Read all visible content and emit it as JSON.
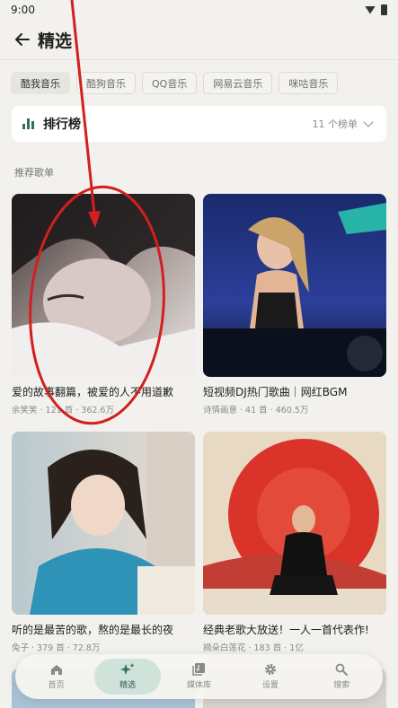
{
  "status": {
    "time": "9:00"
  },
  "header": {
    "title": "精选"
  },
  "sources": [
    "酷我音乐",
    "酷狗音乐",
    "QQ音乐",
    "网易云音乐",
    "咪咕音乐"
  ],
  "rank": {
    "title": "排行榜",
    "count": "11 个榜单"
  },
  "section": {
    "label": "推荐歌单"
  },
  "playlists": [
    {
      "title": "爱的故事翻篇，被爱的人不用道歉",
      "meta": "余笑笑 · 121 首 · 362.6万"
    },
    {
      "title": "短视频DJ热门歌曲｜网红BGM",
      "meta": "诗情画意 · 41 首 · 460.5万"
    },
    {
      "title": "听的是最苦的歌，熬的是最长的夜",
      "meta": "兔子 · 379 首 · 72.8万"
    },
    {
      "title": "经典老歌大放送！一人一首代表作!",
      "meta": "摘朵白莲花 · 183 首 · 1亿"
    }
  ],
  "nav": [
    {
      "label": "首页",
      "icon": "home-icon"
    },
    {
      "label": "精选",
      "icon": "sparkle-icon"
    },
    {
      "label": "媒体库",
      "icon": "library-icon"
    },
    {
      "label": "设置",
      "icon": "gear-icon"
    },
    {
      "label": "搜索",
      "icon": "search-icon"
    }
  ],
  "colors": {
    "accent": "#2f6f62",
    "nav_active": "#cfe3da",
    "annotation": "#d21f1f"
  }
}
